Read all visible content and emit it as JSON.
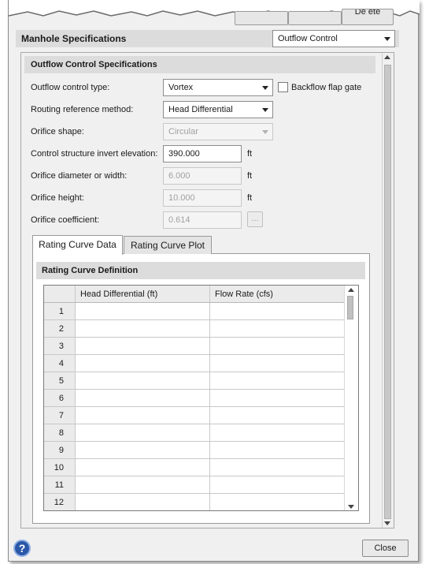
{
  "top_buttons": {
    "delete_label": "De ete"
  },
  "specs": {
    "title": "Manhole Specifications",
    "section_select": "Outflow Control"
  },
  "outflow": {
    "title": "Outflow Control Specifications",
    "type_label": "Outflow control type:",
    "type_value": "Vortex",
    "backflow_label": "Backflow flap gate",
    "routing_label": "Routing reference method:",
    "routing_value": "Head Differential",
    "shape_label": "Orifice shape:",
    "shape_value": "Circular",
    "invert_label": "Control structure invert elevation:",
    "invert_value": "390.000",
    "invert_unit": "ft",
    "diameter_label": "Orifice diameter or width:",
    "diameter_value": "6.000",
    "diameter_unit": "ft",
    "height_label": "Orifice height:",
    "height_value": "10.000",
    "height_unit": "ft",
    "coef_label": "Orifice coefficient:",
    "coef_value": "0.614",
    "coef_button": "..."
  },
  "tabs": [
    {
      "label": "Rating Curve Data",
      "active": true
    },
    {
      "label": "Rating Curve Plot",
      "active": false
    }
  ],
  "rating": {
    "title": "Rating Curve Definition",
    "columns": [
      "Head Differential (ft)",
      "Flow Rate (cfs)"
    ],
    "rows": [
      "1",
      "2",
      "3",
      "4",
      "5",
      "6",
      "7",
      "8",
      "9",
      "10",
      "11",
      "12"
    ]
  },
  "footer": {
    "help_label": "?",
    "close_label": "Close"
  },
  "icons": {
    "help": "help-icon",
    "dropdown": "chevron-down-icon"
  }
}
